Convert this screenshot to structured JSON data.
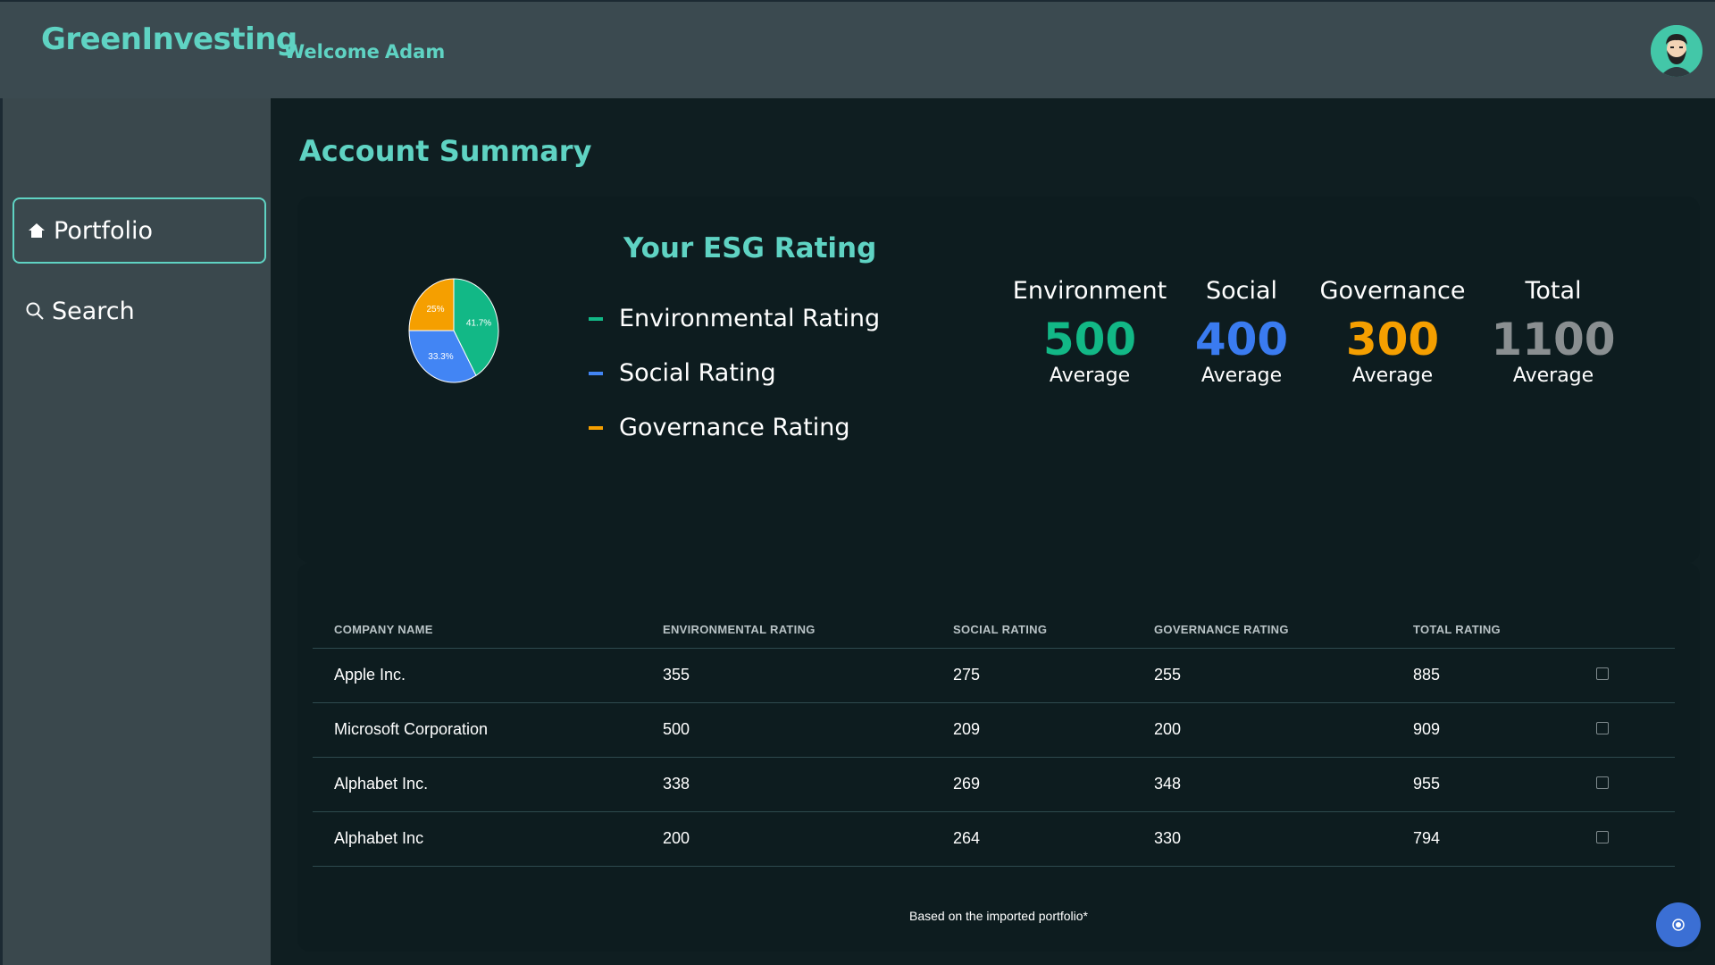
{
  "header": {
    "logo": "GreenInvesting",
    "welcome_word": "Welcome",
    "user_name": "Adam"
  },
  "sidebar": {
    "items": [
      {
        "label": "Portfolio",
        "icon": "home-icon",
        "active": true
      },
      {
        "label": "Search",
        "icon": "search-icon",
        "active": false
      }
    ]
  },
  "main": {
    "title": "Account Summary",
    "esg": {
      "title": "Your ESG Rating",
      "legend": [
        {
          "label": "Environmental Rating",
          "color": "#12b886"
        },
        {
          "label": "Social Rating",
          "color": "#4285f4"
        },
        {
          "label": "Governance Rating",
          "color": "#f59f00"
        }
      ],
      "pie": {
        "slices": [
          {
            "label": "41.7%",
            "value": 41.7,
            "color": "#12b886"
          },
          {
            "label": "33.3%",
            "value": 33.3,
            "color": "#4285f4"
          },
          {
            "label": "25%",
            "value": 25,
            "color": "#f59f00"
          }
        ]
      }
    },
    "stats": [
      {
        "label": "Environment",
        "value": "500",
        "sub": "Average",
        "color": "#12b886"
      },
      {
        "label": "Social",
        "value": "400",
        "sub": "Average",
        "color": "#3a7bf0"
      },
      {
        "label": "Governance",
        "value": "300",
        "sub": "Average",
        "color": "#f59f00"
      },
      {
        "label": "Total",
        "value": "1100",
        "sub": "Average",
        "color": "#8a8f91"
      }
    ],
    "table": {
      "headers": [
        "COMPANY NAME",
        "ENVIRONMENTAL RATING",
        "SOCIAL RATING",
        "GOVERNANCE RATING",
        "TOTAL RATING"
      ],
      "rows": [
        [
          "Apple Inc.",
          "355",
          "275",
          "255",
          "885"
        ],
        [
          "Microsoft Corporation",
          "500",
          "209",
          "200",
          "909"
        ],
        [
          "Alphabet Inc.",
          "338",
          "269",
          "348",
          "955"
        ],
        [
          "Alphabet Inc",
          "200",
          "264",
          "330",
          "794"
        ]
      ],
      "footnote": "Based on the imported portfolio*"
    }
  }
}
